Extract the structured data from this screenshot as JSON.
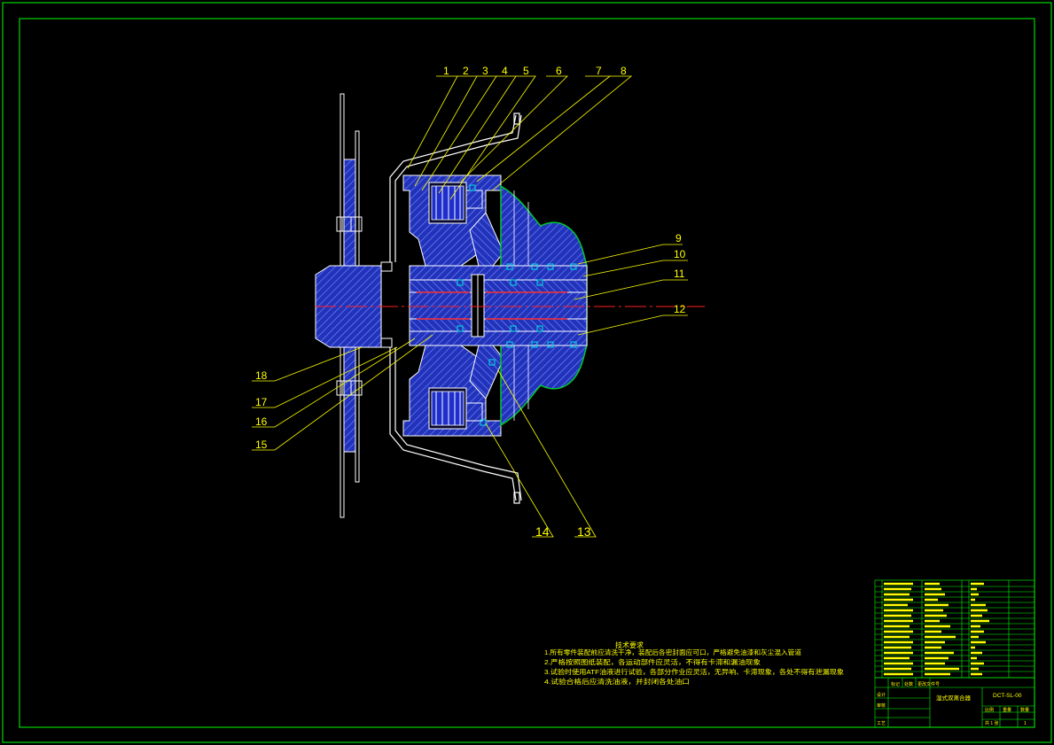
{
  "drawing": {
    "callouts_top": [
      "1",
      "2",
      "3",
      "4",
      "5",
      "6",
      "7",
      "8"
    ],
    "callouts_right": [
      "9",
      "10",
      "11",
      "12"
    ],
    "callouts_left": [
      "18",
      "17",
      "16",
      "15"
    ],
    "callouts_bottom": [
      "14",
      "13"
    ]
  },
  "tech_requirements": {
    "title": "技术要求",
    "items": [
      "1.所有零件装配前应清洗干净，装配后各密封面应可口，严格避免油漆和灰尘混入管道",
      "2.严格按照图纸装配，各运动部件应灵活，不得有卡滞和漏油现象",
      "3.试验时使用ATF油液进行试验，各部分作业应灵活，无异响、卡滞现象，各处不得有泄漏现象",
      "4.试验合格后应清洗油液，并封闭各处油口"
    ]
  },
  "title_block": {
    "drawing_name": "湿式双离合器",
    "drawing_number": "DCT-SL-00",
    "scale_header": "比例",
    "weight_header": "重量",
    "quantity_header": "数量",
    "sheet": "共 1 张",
    "sheet_value": "1",
    "roles": [
      "设计",
      "审核",
      "工艺"
    ],
    "sign_cols": [
      "标记",
      "处数",
      "更改文件号"
    ]
  },
  "colors": {
    "frame": "#00ff00",
    "annotation": "#ffff00",
    "section_fill": "#2233bb",
    "hatch": "#7d8dff",
    "outline": "#ffffff",
    "centerline": "#ff2020",
    "housing": "#00c832"
  }
}
